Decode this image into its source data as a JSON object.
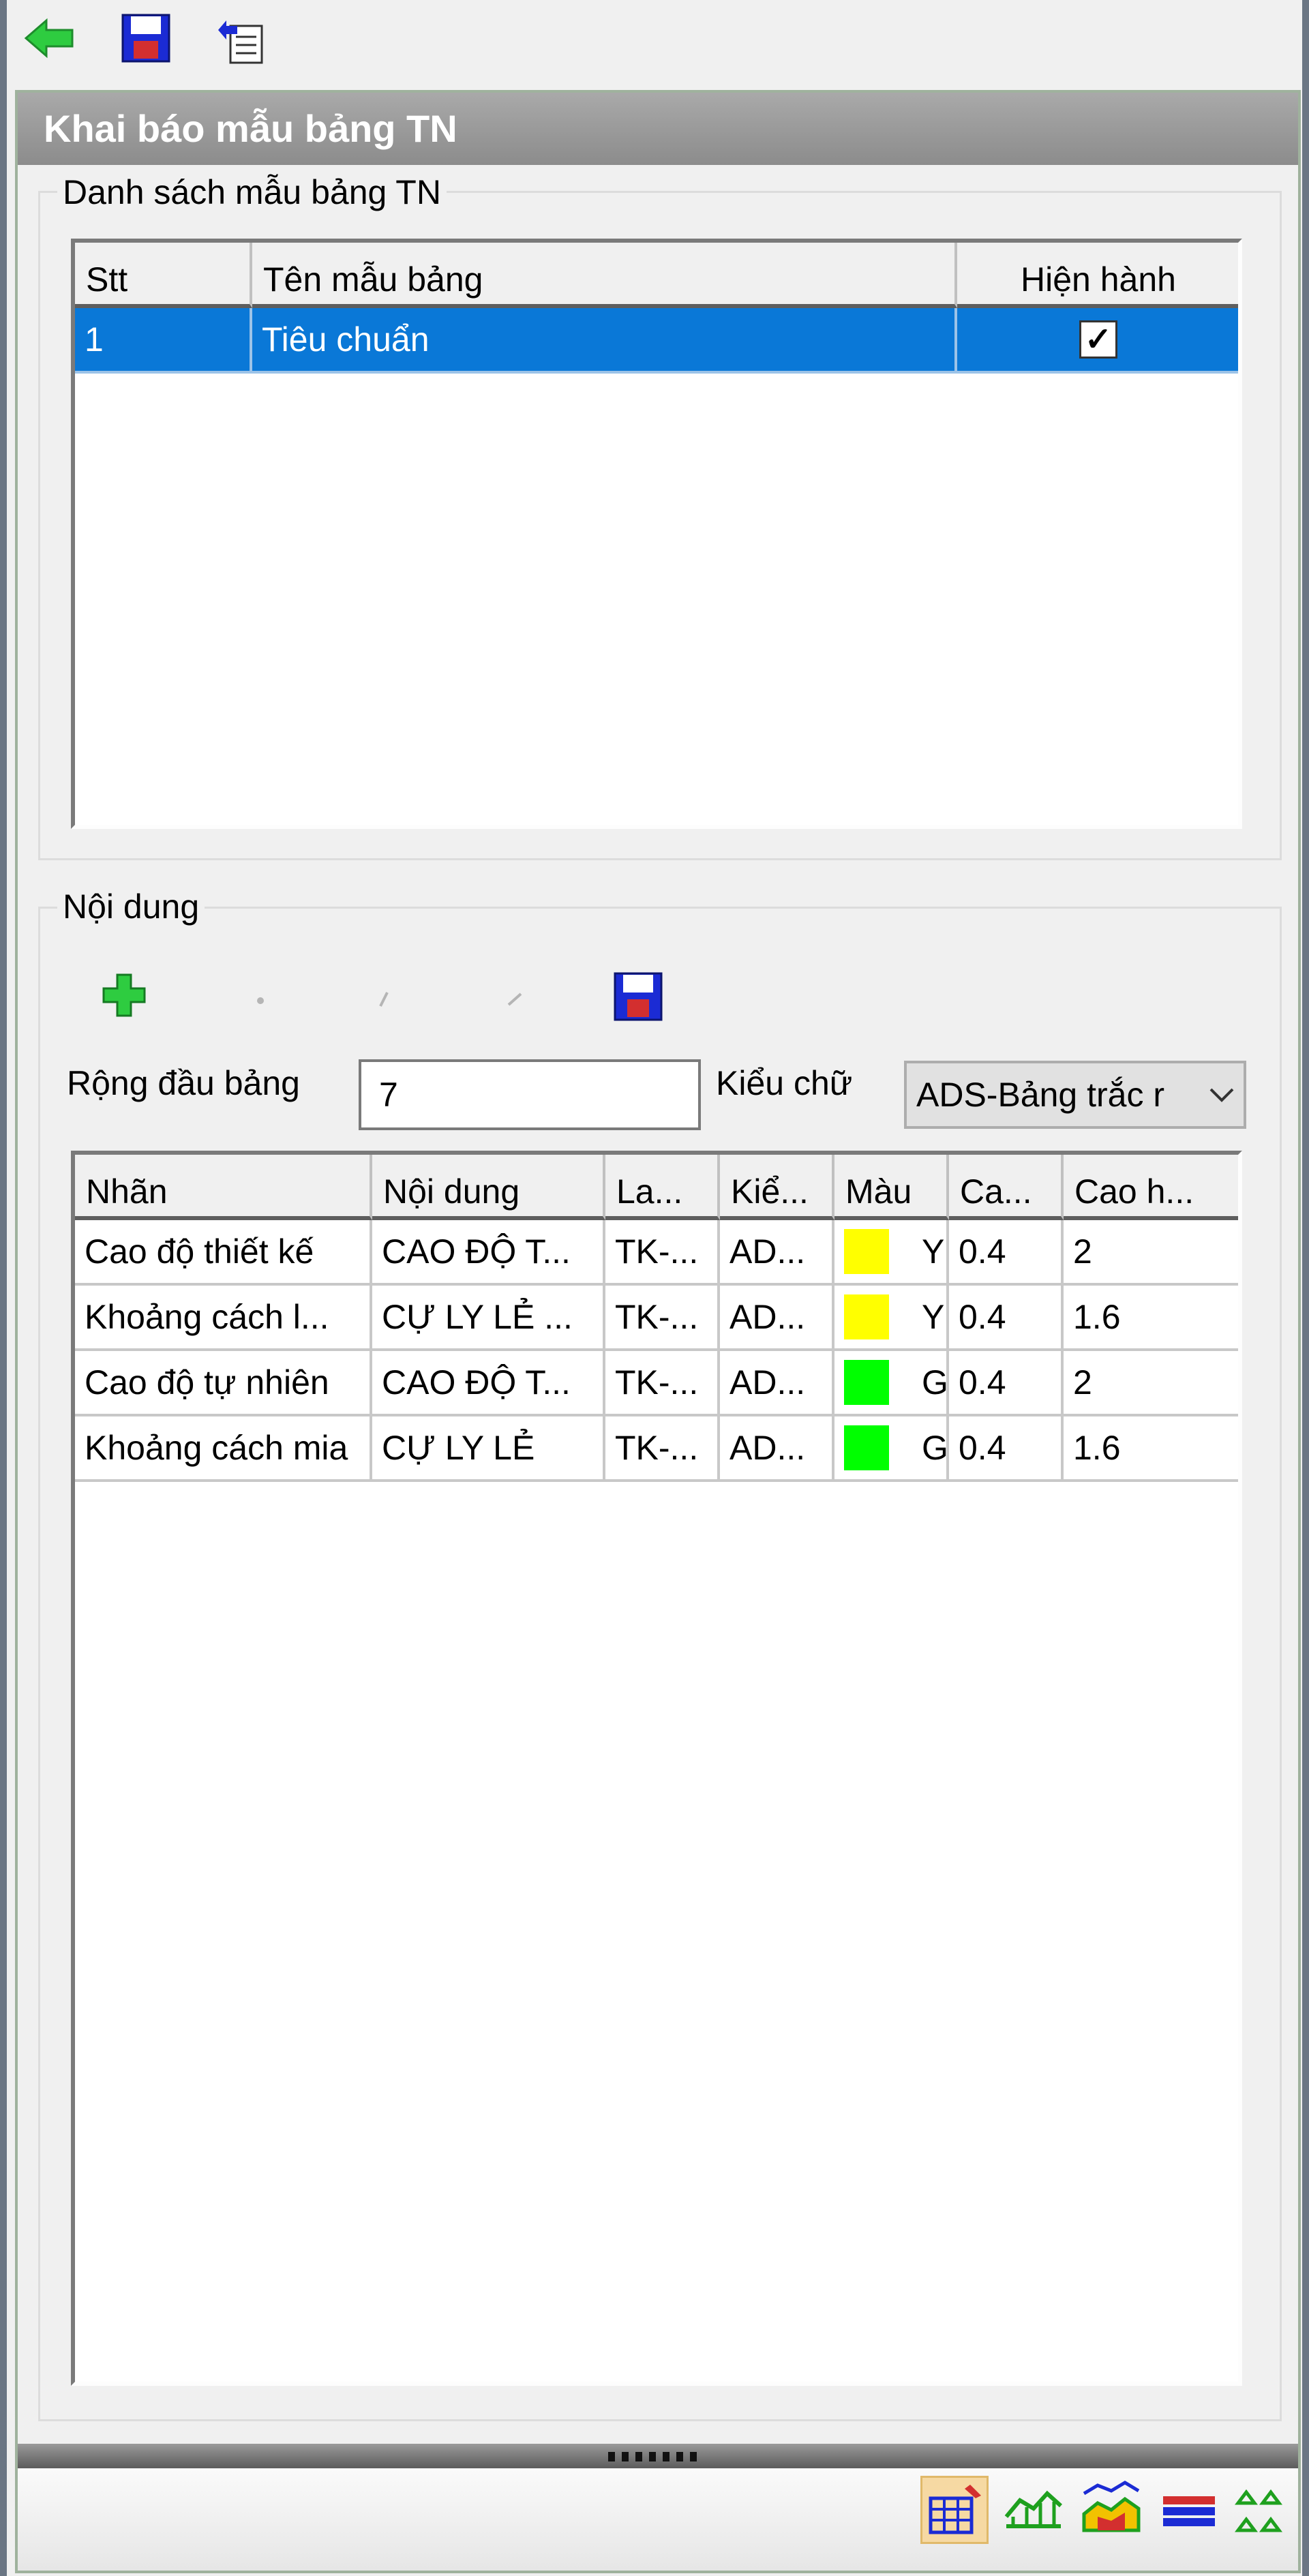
{
  "toolbar": {
    "icons": [
      "back-arrow-icon",
      "save-icon",
      "copy-template-icon"
    ]
  },
  "panel": {
    "title": "Khai báo mẫu bảng TN"
  },
  "templates_group": {
    "legend": "Danh sách mẫu bảng TN",
    "columns": [
      "Stt",
      "Tên mẫu bảng",
      "Hiện hành"
    ],
    "rows": [
      {
        "stt": "1",
        "name": "Tiêu chuẩn",
        "current": true,
        "selected": true
      }
    ]
  },
  "content_group": {
    "legend": "Nội dung",
    "toolbar_icons": [
      "add-icon",
      "delete-icon",
      "move-up-icon",
      "move-down-icon",
      "save-icon"
    ],
    "header_width_label": "Rộng đầu bảng",
    "header_width_value": "7",
    "font_style_label": "Kiểu chữ",
    "font_style_value": "ADS-Bảng trắc r",
    "columns": [
      "Nhãn",
      "Nội dung",
      "La...",
      "Kiể...",
      "Màu",
      "Ca...",
      "Cao h..."
    ],
    "rows": [
      {
        "label": "Cao độ thiết kế",
        "content": "CAO ĐỘ T...",
        "layer": "TK-...",
        "style": "AD...",
        "color": "#ffff00",
        "color_text": "Y",
        "ca": "0.4",
        "height": "2"
      },
      {
        "label": "Khoảng cách l...",
        "content": "CỰ LY LẺ ...",
        "layer": "TK-...",
        "style": "AD...",
        "color": "#ffff00",
        "color_text": "Y",
        "ca": "0.4",
        "height": "1.6"
      },
      {
        "label": "Cao độ tự nhiên",
        "content": "CAO ĐỘ T...",
        "layer": "TK-...",
        "style": "AD...",
        "color": "#00ff00",
        "color_text": "G",
        "ca": "0.4",
        "height": "2"
      },
      {
        "label": "Khoảng cách mia",
        "content": "CỰ LY LẺ",
        "layer": "TK-...",
        "style": "AD...",
        "color": "#00ff00",
        "color_text": "G",
        "ca": "0.4",
        "height": "1.6"
      }
    ]
  },
  "bottom_bar": {
    "icons": [
      "table-grid-icon",
      "profile-section-icon",
      "terrain-profile-icon",
      "layers-icon",
      "cross-sections-icon"
    ],
    "active_icon": "table-grid-icon"
  },
  "colors": {
    "selection": "#0a78d7",
    "header_bar": "#9a9a9a",
    "icon_green": "#1ea01e",
    "icon_blue": "#1b2bd4"
  }
}
